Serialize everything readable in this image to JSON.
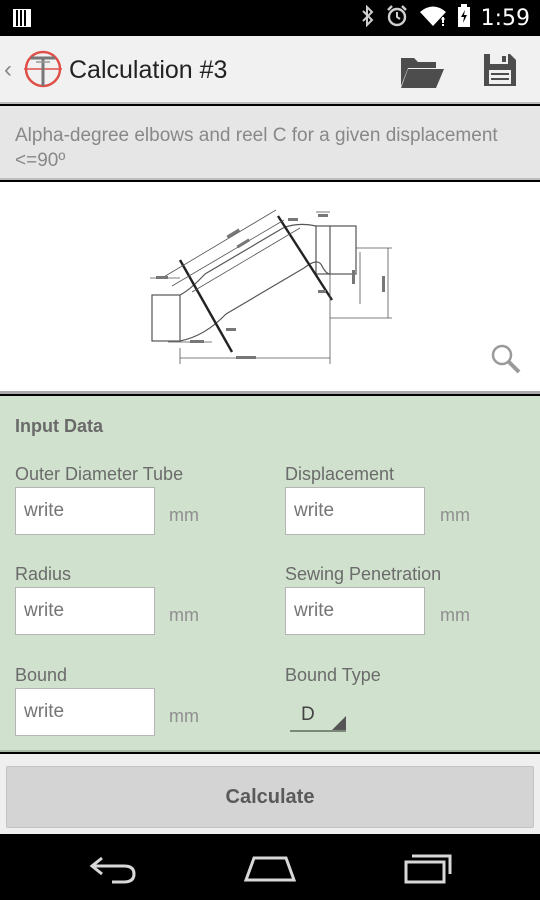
{
  "status_bar": {
    "time": "1:59",
    "icons": [
      "notification-icon",
      "bluetooth-icon",
      "alarm-icon",
      "wifi-icon",
      "battery-icon"
    ]
  },
  "action_bar": {
    "up_glyph": "‹",
    "title": "Calculation #3",
    "actions": [
      "folder-open-icon",
      "save-icon"
    ]
  },
  "subtitle": "Alpha-degree elbows and reel C for a given displacement <=90º",
  "diagram": {
    "image": "elbow-reel-technical-drawing",
    "zoom_icon": "magnifier-icon"
  },
  "input_data": {
    "section_title": "Input Data",
    "fields": [
      {
        "label": "Outer Diameter Tube",
        "placeholder": "write",
        "unit": "mm"
      },
      {
        "label": "Displacement",
        "placeholder": "write",
        "unit": "mm"
      },
      {
        "label": "Radius",
        "placeholder": "write",
        "unit": "mm"
      },
      {
        "label": "Sewing Penetration",
        "placeholder": "write",
        "unit": "mm"
      },
      {
        "label": "Bound",
        "placeholder": "write",
        "unit": "mm"
      }
    ],
    "bound_type": {
      "label": "Bound Type",
      "selected": "D"
    }
  },
  "calculate_button": "Calculate",
  "nav_bar": {
    "icons": [
      "back-icon",
      "home-icon",
      "recent-apps-icon"
    ]
  },
  "colors": {
    "input_panel_bg": "#d0e2cd",
    "action_bar_bg": "#f1f1f1",
    "logo_red": "#e0504a"
  }
}
